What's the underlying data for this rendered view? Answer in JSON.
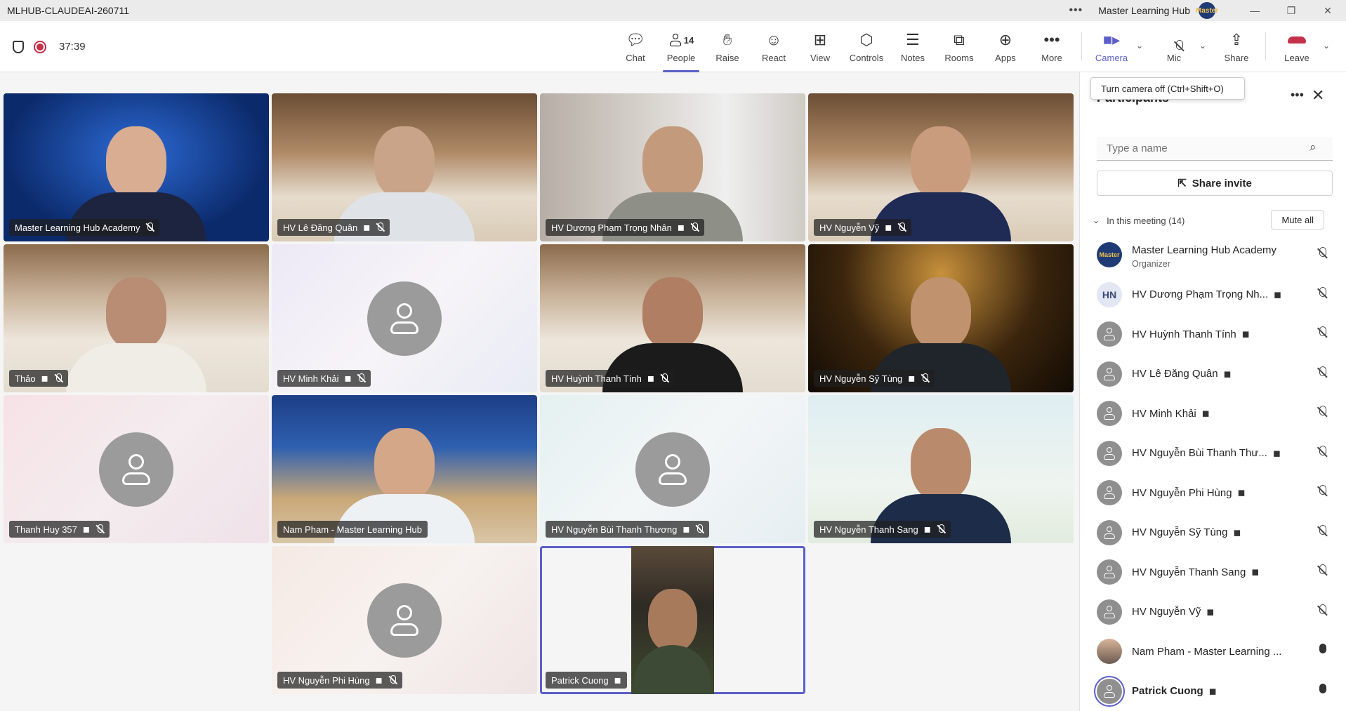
{
  "window": {
    "title": "MLHUB-CLAUDEAI-260711",
    "org_name": "Master Learning Hub",
    "org_logo_text": "Master"
  },
  "toolbar": {
    "timer": "37:39",
    "buttons": {
      "chat": "Chat",
      "people": "People",
      "people_count": "14",
      "raise": "Raise",
      "react": "React",
      "view": "View",
      "controls": "Controls",
      "notes": "Notes",
      "rooms": "Rooms",
      "apps": "Apps",
      "more": "More",
      "camera": "Camera",
      "mic": "Mic",
      "share": "Share",
      "leave": "Leave"
    },
    "tooltip": "Turn camera off (Ctrl+Shift+O)"
  },
  "tiles": [
    {
      "name": "Master Learning Hub Academy"
    },
    {
      "name": "HV Lê Đăng Quân"
    },
    {
      "name": "HV Dương Phạm Trọng Nhân"
    },
    {
      "name": "HV Nguyễn Vỹ"
    },
    {
      "name": "Thảo"
    },
    {
      "name": "HV Minh Khải"
    },
    {
      "name": "HV Huỳnh Thanh Tính"
    },
    {
      "name": "HV Nguyễn Sỹ Tùng"
    },
    {
      "name": "Thanh Huy 357"
    },
    {
      "name": "Nam Pham - Master Learning Hub"
    },
    {
      "name": "HV Nguyễn Bùi Thanh Thương"
    },
    {
      "name": "HV Nguyễn Thanh Sang"
    },
    {
      "name": "HV Nguyễn Phi Hùng"
    },
    {
      "name": "Patrick Cuong"
    }
  ],
  "panel": {
    "title": "Participants",
    "search_placeholder": "Type a name",
    "share_invite": "Share invite",
    "section_label": "In this meeting (14)",
    "mute_all": "Mute all",
    "participants": [
      {
        "name": "Master Learning Hub Academy",
        "sub": "Organizer",
        "avatar": "Master"
      },
      {
        "name": "HV Dương Phạm Trọng Nh...",
        "avatar": "HN"
      },
      {
        "name": "HV Huỳnh Thanh Tính"
      },
      {
        "name": "HV Lê Đăng Quân"
      },
      {
        "name": "HV Minh Khải"
      },
      {
        "name": "HV Nguyễn Bùi Thanh Thư..."
      },
      {
        "name": "HV Nguyễn Phi Hùng"
      },
      {
        "name": "HV Nguyễn Sỹ Tùng"
      },
      {
        "name": "HV Nguyễn Thanh Sang"
      },
      {
        "name": "HV Nguyễn Vỹ"
      },
      {
        "name": "Nam Pham - Master Learning ..."
      },
      {
        "name": "Patrick Cuong"
      }
    ]
  },
  "colors": {
    "accent": "#5b5fc7",
    "leave": "#c4314b"
  }
}
